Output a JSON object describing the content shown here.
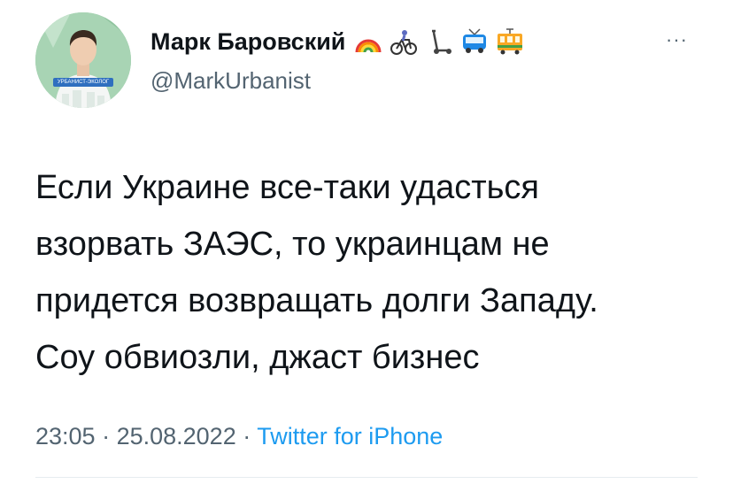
{
  "author": {
    "name": "Марк Баровский",
    "handle": "@MarkUrbanist",
    "avatar_badge_text": "УРБАНИСТ-ЭКОЛОГ",
    "name_emojis": [
      "rainbow-icon",
      "cyclist-icon",
      "kick-scooter-icon",
      "trolleybus-icon",
      "tram-icon"
    ]
  },
  "more_glyph": "···",
  "tweet": {
    "lines": [
      "Если Украине все-таки удасться",
      "взорвать ЗАЭС, то украинцам не",
      "придется возвращать долги Западу.",
      "Соу обвиозли, джаст бизнес"
    ]
  },
  "meta": {
    "time": "23:05",
    "separator1": " · ",
    "date": "25.08.2022",
    "separator2": " · ",
    "source": "Twitter for iPhone"
  },
  "colors": {
    "text": "#0f1419",
    "secondary": "#536471",
    "link": "#1d9bf0"
  }
}
